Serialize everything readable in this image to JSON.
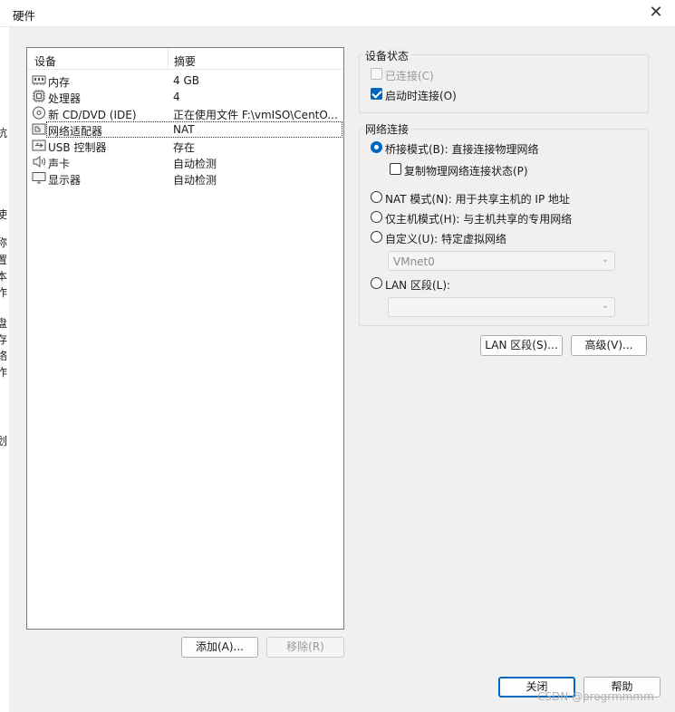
{
  "window": {
    "title": "硬件",
    "close_glyph": "✕"
  },
  "left_strip_glyphs": [
    "抗",
    "使",
    "称",
    "置",
    "本",
    "作",
    "盘",
    "存",
    "络",
    "作",
    "划"
  ],
  "device_list": {
    "columns": [
      "设备",
      "摘要"
    ],
    "rows": [
      {
        "name": "内存",
        "summary": "4 GB",
        "icon": "memory-icon"
      },
      {
        "name": "处理器",
        "summary": "4",
        "icon": "processor-icon"
      },
      {
        "name": "新 CD/DVD (IDE)",
        "summary": "正在使用文件 F:\\vmISO\\CentO...",
        "icon": "cd-dvd-icon"
      },
      {
        "name": "网络适配器",
        "summary": "NAT",
        "icon": "network-adapter-icon",
        "selected": true
      },
      {
        "name": "USB 控制器",
        "summary": "存在",
        "icon": "usb-icon"
      },
      {
        "name": "声卡",
        "summary": "自动检测",
        "icon": "sound-card-icon"
      },
      {
        "name": "显示器",
        "summary": "自动检测",
        "icon": "display-icon"
      }
    ]
  },
  "buttons": {
    "add": "添加(A)...",
    "remove": "移除(R)",
    "lan_segments": "LAN 区段(S)...",
    "advanced": "高级(V)...",
    "close": "关闭",
    "help": "帮助"
  },
  "device_status": {
    "title": "设备状态",
    "connected": {
      "label": "已连接(C)",
      "checked": false,
      "enabled": false
    },
    "connect_at_power_on": {
      "label": "启动时连接(O)",
      "checked": true,
      "enabled": true
    }
  },
  "network_connection": {
    "title": "网络连接",
    "bridged": "桥接模式(B): 直接连接物理网络",
    "replicate": "复制物理网络连接状态(P)",
    "nat": "NAT 模式(N): 用于共享主机的 IP 地址",
    "host_only": "仅主机模式(H): 与主机共享的专用网络",
    "custom": "自定义(U): 特定虚拟网络",
    "custom_select_value": "VMnet0",
    "lan_segment": "LAN 区段(L):",
    "lan_select_value": "",
    "selected": "bridged"
  },
  "watermark": "CSDN @progrmmmm",
  "colors": {
    "accent": "#0067c0",
    "dialog_bg": "#f0f0f0"
  }
}
